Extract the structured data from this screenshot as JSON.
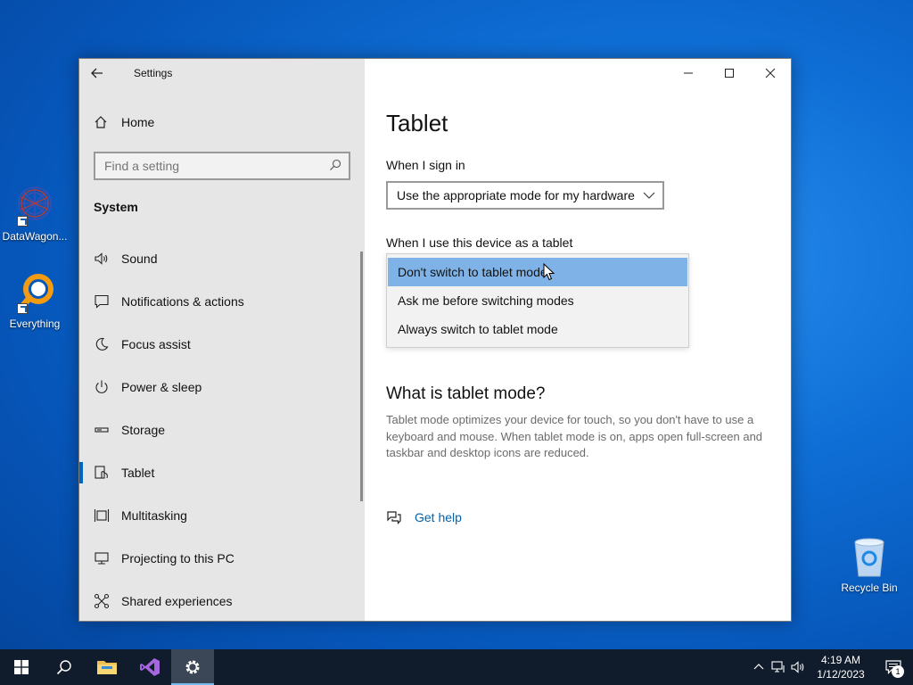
{
  "desktop": {
    "icons": [
      {
        "label": "DataWagon..."
      },
      {
        "label": "Everything"
      }
    ],
    "recycle_bin": {
      "label": "Recycle Bin"
    }
  },
  "window": {
    "title": "Settings",
    "sidebar": {
      "home_label": "Home",
      "search": {
        "placeholder": "Find a setting"
      },
      "section_label": "System",
      "items": [
        {
          "label": "Sound",
          "icon": "speaker-icon"
        },
        {
          "label": "Notifications & actions",
          "icon": "notification-icon"
        },
        {
          "label": "Focus assist",
          "icon": "moon-icon"
        },
        {
          "label": "Power & sleep",
          "icon": "power-icon"
        },
        {
          "label": "Storage",
          "icon": "storage-icon"
        },
        {
          "label": "Tablet",
          "icon": "tablet-icon",
          "active": true
        },
        {
          "label": "Multitasking",
          "icon": "multitasking-icon"
        },
        {
          "label": "Projecting to this PC",
          "icon": "projecting-icon"
        },
        {
          "label": "Shared experiences",
          "icon": "shared-experiences-icon"
        }
      ]
    },
    "content": {
      "page_title": "Tablet",
      "sign_in_label": "When I sign in",
      "sign_in_value": "Use the appropriate mode for my hardware",
      "tablet_use_label": "When I use this device as a tablet",
      "tablet_options": [
        "Don't switch to tablet mode",
        "Ask me before switching modes",
        "Always switch to tablet mode"
      ],
      "selected_option_index": 0,
      "what_is_title": "What is tablet mode?",
      "what_is_description": "Tablet mode optimizes your device for touch, so you don't have to use a keyboard and mouse. When tablet mode is on, apps open full-screen and taskbar and desktop icons are reduced.",
      "get_help_label": "Get help"
    }
  },
  "taskbar": {
    "clock_time": "4:19 AM",
    "clock_date": "1/12/2023",
    "notification_count": "1"
  },
  "colors": {
    "accent": "#0067c0",
    "selection": "#7fb3e8",
    "link": "#0063b1",
    "taskbar": "#101c2c"
  }
}
